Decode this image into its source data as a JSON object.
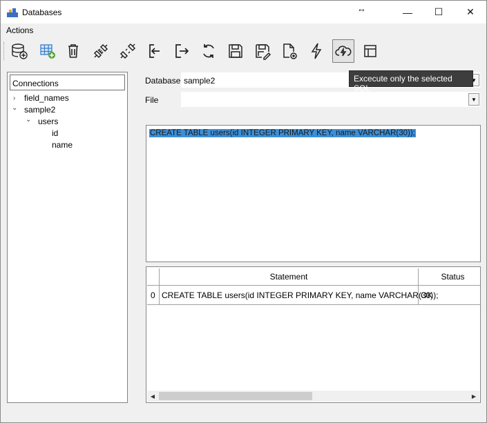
{
  "window": {
    "title": "Databases",
    "resize_cursor": "↔",
    "minimize": "—",
    "maximize": "☐",
    "close": "✕"
  },
  "menu": {
    "actions": "Actions"
  },
  "toolbar": {
    "icons": [
      "add-database-icon",
      "add-table-icon",
      "delete-icon",
      "connect-icon",
      "disconnect-icon",
      "import-icon",
      "export-icon",
      "refresh-icon",
      "save-icon",
      "save-as-icon",
      "new-file-icon",
      "execute-icon",
      "execute-selected-icon",
      "table-view-icon"
    ],
    "tooltip": "Excecute only the selected SQL"
  },
  "tree": {
    "header": "Connections",
    "items": [
      {
        "label": "field_names",
        "arrow": "›"
      },
      {
        "label": "sample2",
        "arrow": "⌄"
      },
      {
        "label": "users",
        "arrow": "⌄"
      },
      {
        "label": "id"
      },
      {
        "label": "name"
      }
    ]
  },
  "form": {
    "database_label": "Database",
    "database_value": "sample2",
    "file_label": "File",
    "file_value": ""
  },
  "editor": {
    "sql": "CREATE TABLE users(id INTEGER PRIMARY KEY, name VARCHAR(30));"
  },
  "results": {
    "columns": [
      "Statement",
      "Status"
    ],
    "rows": [
      {
        "index": "0",
        "statement": "CREATE TABLE users(id INTEGER PRIMARY KEY, name VARCHAR(30));",
        "status": "OK"
      }
    ]
  },
  "colors": {
    "selection": "#3b8fd9",
    "tooltip_bg": "#3d3d3d"
  }
}
